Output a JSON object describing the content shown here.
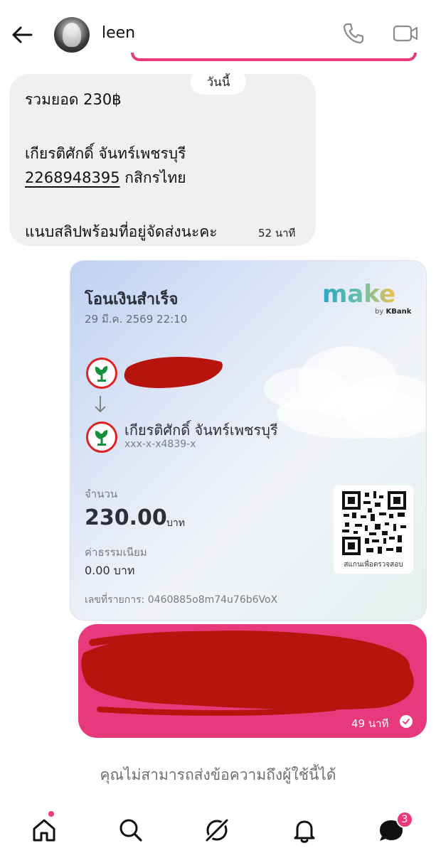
{
  "header": {
    "username": "leen"
  },
  "chat": {
    "date_chip": "วันนี้",
    "incoming": {
      "lines": [
        "รวมยอด 230฿",
        "เกียรติศักดิ์ จันทร์เพชรบุรี",
        "2268948395",
        "กสิกรไทย",
        "แนบสลิปพร้อมที่อยู่จัดส่งนะคะ"
      ],
      "time": "52 นาที"
    },
    "slip": {
      "title": "โอนเงินสำเร็จ",
      "datetime": "29 มี.ค. 2569 22:10",
      "brand": "make",
      "brand_sub": "by",
      "brand_sub_bold": "KBank",
      "receiver_name": "เกียรติศักดิ์ จันทร์เพชรบุรี",
      "receiver_account": "xxx-x-x4839-x",
      "amount_label": "จำนวน",
      "amount": "230.00",
      "amount_unit": "บาท",
      "fee_label": "ค่าธรรมเนียม",
      "fee": "0.00 บาท",
      "ref": "เลขที่รายการ: 0460885o8m74u76b6VoX",
      "qr_caption": "สแกนเพื่อตรวจสอบ"
    },
    "outgoing": {
      "time": "49 นาที"
    },
    "notice": "คุณไม่สามารถส่งข้อความถึงผู้ใช้นี้ได้"
  },
  "nav": {
    "badge_count": "3"
  },
  "colors": {
    "accent": "#e8397c",
    "redact": "#b8140e",
    "bubble_in": "#eef0f1"
  }
}
